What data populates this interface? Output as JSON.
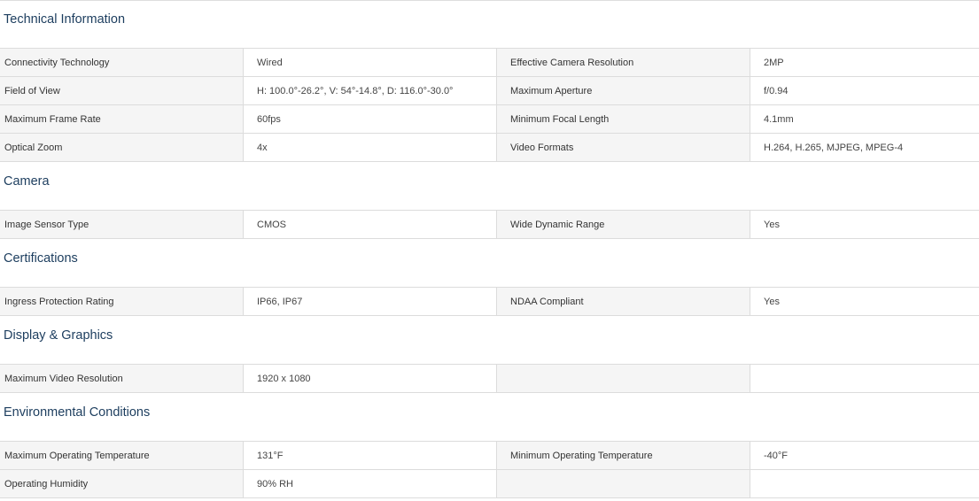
{
  "sections": [
    {
      "title": "Technical Information",
      "rows": [
        [
          "Connectivity Technology",
          "Wired",
          "Effective Camera Resolution",
          "2MP"
        ],
        [
          "Field of View",
          "H: 100.0°-26.2°, V: 54°-14.8°, D: 116.0°-30.0°",
          "Maximum Aperture",
          "f/0.94"
        ],
        [
          "Maximum Frame Rate",
          "60fps",
          "Minimum Focal Length",
          "4.1mm"
        ],
        [
          "Optical Zoom",
          "4x",
          "Video Formats",
          "H.264, H.265, MJPEG, MPEG-4"
        ]
      ]
    },
    {
      "title": "Camera",
      "rows": [
        [
          "Image Sensor Type",
          "CMOS",
          "Wide Dynamic Range",
          "Yes"
        ]
      ]
    },
    {
      "title": "Certifications",
      "rows": [
        [
          "Ingress Protection Rating",
          "IP66, IP67",
          "NDAA Compliant",
          "Yes"
        ]
      ]
    },
    {
      "title": "Display & Graphics",
      "rows": [
        [
          "Maximum Video Resolution",
          "1920 x 1080",
          "",
          ""
        ]
      ]
    },
    {
      "title": "Environmental Conditions",
      "rows": [
        [
          "Maximum Operating Temperature",
          "131°F",
          "Minimum Operating Temperature",
          "-40°F"
        ],
        [
          "Operating Humidity",
          "90% RH",
          "",
          ""
        ]
      ]
    }
  ],
  "colors": {
    "heading": "#1c3d5e",
    "label_bg": "#f5f5f5",
    "border": "#dcdcdc"
  }
}
